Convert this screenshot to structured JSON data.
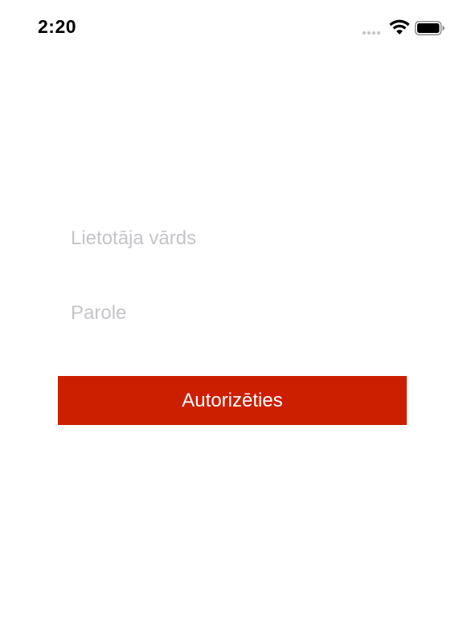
{
  "status_bar": {
    "time": "2:20",
    "wifi_icon": "wifi-icon",
    "battery_icon": "battery-icon"
  },
  "login_form": {
    "username_placeholder": "Lietotāja vārds",
    "username_value": "",
    "password_placeholder": "Parole",
    "password_value": "",
    "submit_label": "Autorizēties"
  },
  "colors": {
    "accent": "#cc1f00",
    "placeholder": "#c4c4c9",
    "background": "#ffffff"
  }
}
